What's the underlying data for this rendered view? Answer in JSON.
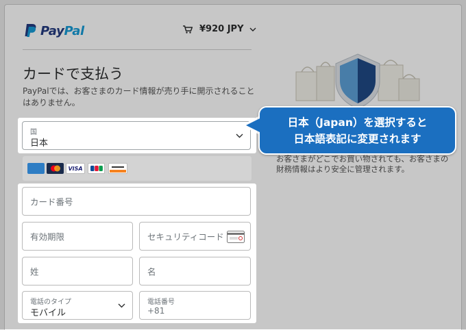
{
  "brand": {
    "pay": "Pay",
    "pal": "Pal"
  },
  "header": {
    "amount": "¥920 JPY"
  },
  "page": {
    "title": "カードで支払う",
    "subtitle": "PayPalでは、お客さまのカード情報が売り手に開示されることはありません。"
  },
  "country": {
    "label": "国",
    "value": "日本"
  },
  "cards": [
    "AMEX",
    "MasterCard",
    "VISA",
    "JCB",
    "DISCOVER"
  ],
  "form": {
    "card_number": "カード番号",
    "expiry": "有効期限",
    "security_code": "セキュリティコード",
    "last_name": "姓",
    "first_name": "名",
    "phone_type_label": "電話のタイプ",
    "phone_type_value": "モバイル",
    "phone_number_label": "電話番号",
    "phone_prefix": "+81"
  },
  "side": {
    "text": "お客さまがどこでお買い物されても、お客さまの財務情報はより安全に管理されます。"
  },
  "callout": {
    "line1": "日本（Japan）を選択すると",
    "line2": "日本語表記に変更されます"
  },
  "colors": {
    "accent": "#1b6fc0",
    "dim": "#8a8a8a"
  }
}
